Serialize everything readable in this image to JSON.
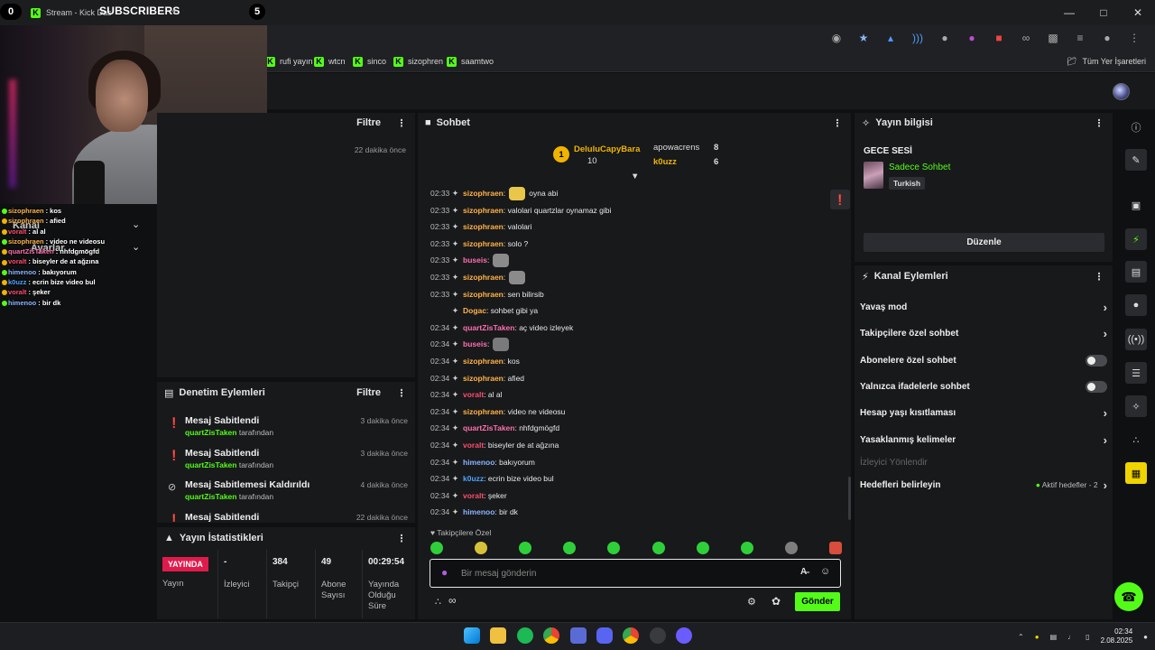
{
  "browser": {
    "tab_title": "Stream - Kick Das",
    "bookmarks": [
      "rufi yayın",
      "wtcn",
      "sinco",
      "sizophren",
      "saamtwo"
    ],
    "all_bookmarks": "Tüm Yer İşaretleri"
  },
  "overlay": {
    "sub_left": "0",
    "sub_title": "SUBSCRIBERS",
    "sub_plus": "+",
    "sub_right": "5",
    "chat": [
      {
        "user": "sizophraen",
        "text": ": kos",
        "color": "#ffb347"
      },
      {
        "user": "sizophraen",
        "text": ": afied",
        "color": "#ffb347"
      },
      {
        "user": "voralt",
        "text": ": al al",
        "color": "#ff4d6d"
      },
      {
        "user": "sizophraen",
        "text": ": video ne videosu",
        "color": "#ffb347"
      },
      {
        "user": "quartZisTaken",
        "text": ": nhfdgmögfd",
        "color": "#ff6fae"
      },
      {
        "user": "voralt",
        "text": ": biseyler de at ağzına",
        "color": "#ff4d6d"
      },
      {
        "user": "himenoo",
        "text": ": bakıyorum",
        "color": "#8ab4ff"
      },
      {
        "user": "k0uzz",
        "text": ": ecrin bize video bul",
        "color": "#4da3ff"
      },
      {
        "user": "voralt",
        "text": ": şeker",
        "color": "#ff4d6d"
      },
      {
        "user": "himenoo",
        "text": ": bir dk",
        "color": "#8ab4ff"
      }
    ]
  },
  "panel_top": {
    "filter_label": "Filtre",
    "time": "22 dakika önce",
    "row1": "Kanal",
    "row2": "Ayarlar"
  },
  "mod_actions": {
    "title": "Denetim Eylemleri",
    "filter_label": "Filtre",
    "items": [
      {
        "title": "Mesaj Sabitlendi",
        "by": "quartZisTaken",
        "by_suffix": "tarafından",
        "time": "3 dakika önce"
      },
      {
        "title": "Mesaj Sabitlendi",
        "by": "quartZisTaken",
        "by_suffix": "tarafından",
        "time": "3 dakika önce"
      },
      {
        "title": "Mesaj Sabitlemesi Kaldırıldı",
        "by": "quartZisTaken",
        "by_suffix": "tarafından",
        "time": "4 dakika önce"
      },
      {
        "title": "Mesaj Sabitlendi",
        "by": "",
        "by_suffix": "",
        "time": "22 dakika önce"
      }
    ]
  },
  "stats": {
    "title": "Yayın İstatistikleri",
    "live_badge": "YAYINDA",
    "cells": [
      {
        "value": "",
        "label": "Yayın"
      },
      {
        "value": "-",
        "label": "İzleyici"
      },
      {
        "value": "384",
        "label": "Takipçi"
      },
      {
        "value": "49",
        "label": "Abone Sayısı"
      },
      {
        "value": "00:29:54",
        "label": "Yayında Olduğu Süre"
      }
    ]
  },
  "chat": {
    "title": "Sohbet",
    "top_chatters": [
      {
        "rank": "1",
        "name": "DeluluCapyBara",
        "count": "10"
      },
      {
        "name": "apowacrens",
        "count": "8"
      },
      {
        "name": "k0uzz",
        "count": "6"
      }
    ],
    "messages": [
      {
        "ts": "02:33",
        "user": "sizophraen",
        "color": "#ffb347",
        "text": "oyna abi",
        "emote": true
      },
      {
        "ts": "02:33",
        "user": "sizophraen",
        "color": "#ffb347",
        "text": ": valolari quartzlar oynamaz gibi"
      },
      {
        "ts": "02:33",
        "user": "sizophraen",
        "color": "#ffb347",
        "text": ": valolari"
      },
      {
        "ts": "02:33",
        "user": "sizophraen",
        "color": "#ffb347",
        "text": ": solo ?"
      },
      {
        "ts": "02:33",
        "user": "buseis",
        "color": "#ff6fae",
        "text": "",
        "emote": true
      },
      {
        "ts": "02:33",
        "user": "sizophraen",
        "color": "#ffb347",
        "text": "",
        "emote": true
      },
      {
        "ts": "02:33",
        "user": "sizophraen",
        "color": "#ffb347",
        "text": ": sen bilirsib"
      },
      {
        "ts": "",
        "user": "Dogac",
        "color": "#ffb347",
        "text": ": sohbet gibi ya"
      },
      {
        "ts": "02:34",
        "user": "quartZisTaken",
        "color": "#ff6fae",
        "text": ": aç video izleyek"
      },
      {
        "ts": "02:34",
        "user": "buseis",
        "color": "#ff6fae",
        "text": "",
        "emote": true
      },
      {
        "ts": "02:34",
        "user": "sizophraen",
        "color": "#ffb347",
        "text": ": kos"
      },
      {
        "ts": "02:34",
        "user": "sizophraen",
        "color": "#ffb347",
        "text": ": afied"
      },
      {
        "ts": "02:34",
        "user": "voralt",
        "color": "#ff4d6d",
        "text": ": al al"
      },
      {
        "ts": "02:34",
        "user": "sizophraen",
        "color": "#ffb347",
        "text": ": video ne videosu"
      },
      {
        "ts": "02:34",
        "user": "quartZisTaken",
        "color": "#ff6fae",
        "text": ": nhfdgmögfd"
      },
      {
        "ts": "02:34",
        "user": "voralt",
        "color": "#ff4d6d",
        "text": ": biseyler de at ağzına"
      },
      {
        "ts": "02:34",
        "user": "himenoo",
        "color": "#8ab4ff",
        "text": ": bakıyorum"
      },
      {
        "ts": "02:34",
        "user": "k0uzz",
        "color": "#4da3ff",
        "text": ": ecrin bize video bul"
      },
      {
        "ts": "02:34",
        "user": "voralt",
        "color": "#ff4d6d",
        "text": ": şeker"
      },
      {
        "ts": "02:34",
        "user": "himenoo",
        "color": "#8ab4ff",
        "text": ": bir dk"
      }
    ],
    "followers_only": "Takipçilere Özel",
    "input_placeholder": "Bir mesaj gönderin",
    "send_label": "Gönder"
  },
  "stream_info": {
    "title": "Yayın bilgisi",
    "stream_title": "GECE SESİ",
    "category": "Sadece Sohbet",
    "language": "Turkish",
    "edit_label": "Düzenle"
  },
  "channel_actions": {
    "title": "Kanal Eylemleri",
    "items": [
      {
        "label": "Yavaş mod",
        "control": "chevron"
      },
      {
        "label": "Takipçilere özel sohbet",
        "control": "chevron"
      },
      {
        "label": "Abonelere özel sohbet",
        "control": "toggle"
      },
      {
        "label": "Yalnızca ifadelerle sohbet",
        "control": "toggle"
      },
      {
        "label": "Hesap yaşı kısıtlaması",
        "control": "chevron"
      },
      {
        "label": "Yasaklanmış kelimeler",
        "control": "chevron"
      },
      {
        "label": "İzleyici Yönlendir",
        "control": "none",
        "disabled": true
      },
      {
        "label": "Hedefleri belirleyin",
        "control": "chevron",
        "extra": "Aktif hedefler - 2"
      }
    ]
  },
  "taskbar": {
    "time": "02:34",
    "date": "2.08.2025"
  },
  "colors": {
    "accent": "#53fc18",
    "panel": "#18191b",
    "background": "#0f1011",
    "live": "#e01b4c"
  }
}
